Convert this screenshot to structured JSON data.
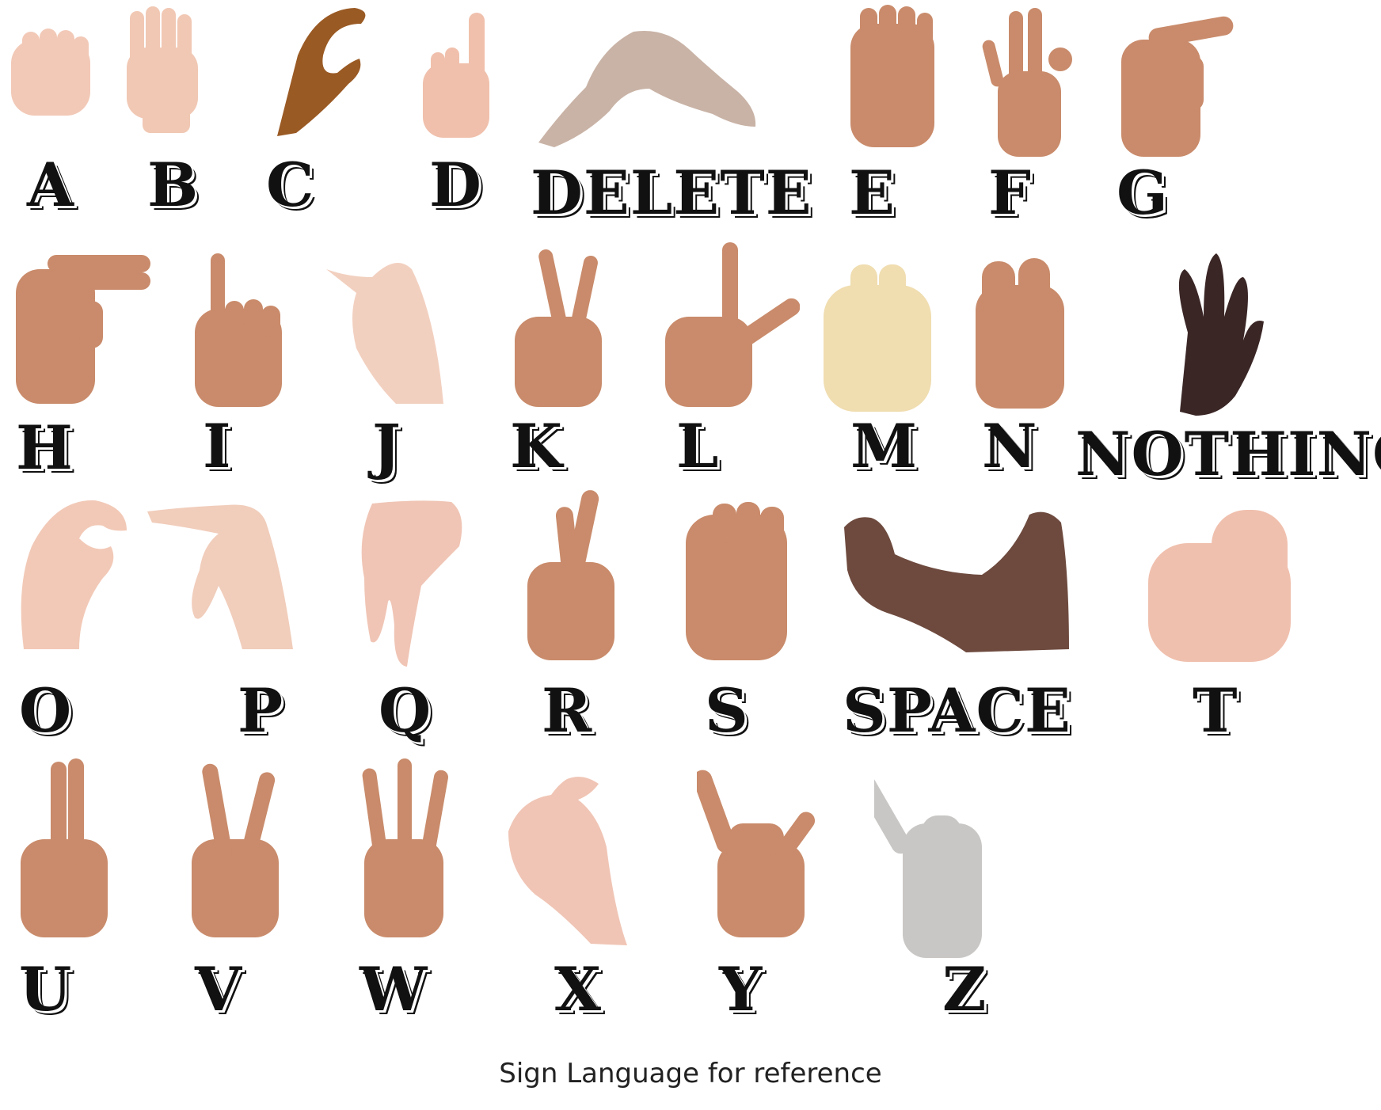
{
  "signs": [
    {
      "label": "A",
      "icon": "hand-sign-a-icon",
      "skin": "#f2c9b7"
    },
    {
      "label": "B",
      "icon": "hand-sign-b-icon",
      "skin": "#f1c8b4"
    },
    {
      "label": "C",
      "icon": "hand-sign-c-icon",
      "skin": "#9a5a24"
    },
    {
      "label": "D",
      "icon": "hand-sign-d-icon",
      "skin": "#f0c0ac"
    },
    {
      "label": "DELETE",
      "icon": "hand-sign-delete-icon",
      "skin": "#c9b3a6"
    },
    {
      "label": "E",
      "icon": "hand-sign-e-icon",
      "skin": "#c98b6b"
    },
    {
      "label": "F",
      "icon": "hand-sign-f-icon",
      "skin": "#c98b6b"
    },
    {
      "label": "G",
      "icon": "hand-sign-g-icon",
      "skin": "#c98b6b"
    },
    {
      "label": "H",
      "icon": "hand-sign-h-icon",
      "skin": "#c98b6b"
    },
    {
      "label": "I",
      "icon": "hand-sign-i-icon",
      "skin": "#c98b6b"
    },
    {
      "label": "J",
      "icon": "hand-sign-j-icon",
      "skin": "#f2d0c0"
    },
    {
      "label": "K",
      "icon": "hand-sign-k-icon",
      "skin": "#c98b6b"
    },
    {
      "label": "L",
      "icon": "hand-sign-l-icon",
      "skin": "#c98b6b"
    },
    {
      "label": "M",
      "icon": "hand-sign-m-icon",
      "skin": "#f0ddb0"
    },
    {
      "label": "N",
      "icon": "hand-sign-n-icon",
      "skin": "#c98b6b"
    },
    {
      "label": "NOTHING",
      "icon": "hand-sign-nothing-icon",
      "skin": "#3b2626"
    },
    {
      "label": "O",
      "icon": "hand-sign-o-icon",
      "skin": "#f2c9b7"
    },
    {
      "label": "P",
      "icon": "hand-sign-p-icon",
      "skin": "#f1cdbb"
    },
    {
      "label": "Q",
      "icon": "hand-sign-q-icon",
      "skin": "#f0c5b5"
    },
    {
      "label": "R",
      "icon": "hand-sign-r-icon",
      "skin": "#c98b6b"
    },
    {
      "label": "S",
      "icon": "hand-sign-s-icon",
      "skin": "#c98b6b"
    },
    {
      "label": "SPACE",
      "icon": "hand-sign-space-icon",
      "skin": "#6e4a3e"
    },
    {
      "label": "T",
      "icon": "hand-sign-t-icon",
      "skin": "#f0c0ae"
    },
    {
      "label": "U",
      "icon": "hand-sign-u-icon",
      "skin": "#c98b6b"
    },
    {
      "label": "V",
      "icon": "hand-sign-v-icon",
      "skin": "#c98b6b"
    },
    {
      "label": "W",
      "icon": "hand-sign-w-icon",
      "skin": "#c98b6b"
    },
    {
      "label": "X",
      "icon": "hand-sign-x-icon",
      "skin": "#f0c5b5"
    },
    {
      "label": "Y",
      "icon": "hand-sign-y-icon",
      "skin": "#c98b6b"
    },
    {
      "label": "Z",
      "icon": "hand-sign-z-icon",
      "skin": "#c9c7c5"
    }
  ],
  "caption": "Sign Language for reference"
}
